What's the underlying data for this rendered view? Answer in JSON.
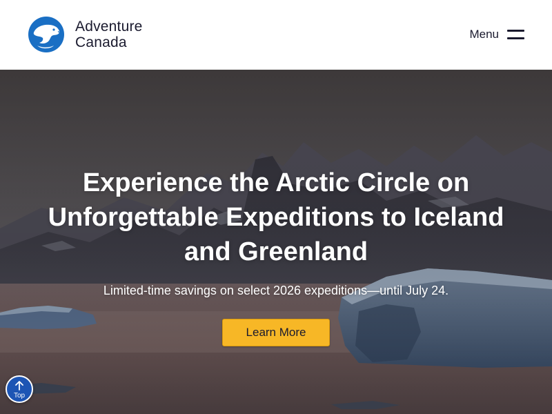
{
  "header": {
    "logo_line1": "Adventure",
    "logo_line2": "Canada",
    "logo_icon": "polar-bear-logo-icon",
    "menu_label": "Menu",
    "menu_icon": "hamburger-icon"
  },
  "hero": {
    "title": "Experience the Arctic Circle on Unforgettable Expeditions to Iceland and Greenland",
    "subtitle": "Limited-time savings on select 2026 expeditions—until July 24.",
    "cta_label": "Learn More"
  },
  "scroll_top": {
    "label": "Top",
    "icon": "arrow-up-icon"
  },
  "colors": {
    "brand_blue": "#1a6fc4",
    "cta_yellow": "#f7b726",
    "top_button_blue": "#1d55b4",
    "text_dark": "#1a1a2e"
  }
}
